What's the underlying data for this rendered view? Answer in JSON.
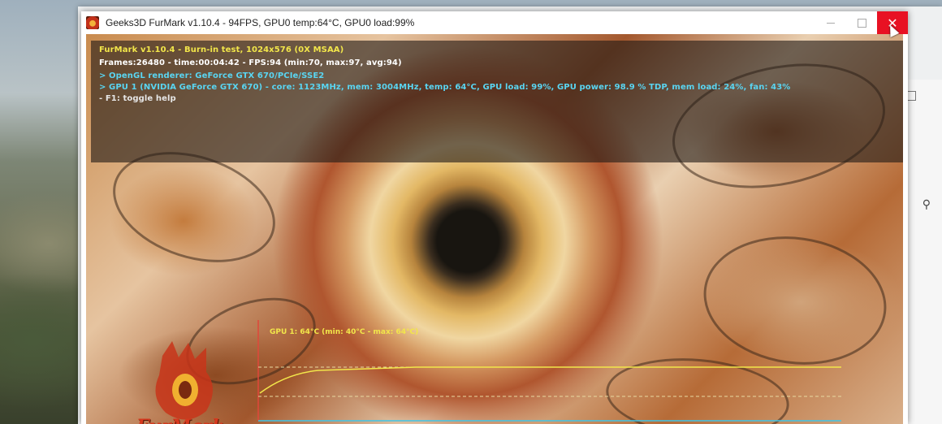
{
  "window": {
    "title": "Geeks3D FurMark v1.10.4 - 94FPS, GPU0 temp:64°C, GPU0 load:99%",
    "close_glyph": "✕"
  },
  "overlay": {
    "title_line": "FurMark v1.10.4 - Burn-in test, 1024x576 (0X MSAA)",
    "frames_line": "Frames:26480 - time:00:04:42 - FPS:94 (min:70, max:97, avg:94)",
    "renderer_line": "> OpenGL renderer: GeForce GTX 670/PCIe/SSE2",
    "gpu_line": "> GPU 1 (NVIDIA GeForce GTX 670) - core: 1123MHz, mem: 3004MHz, temp: 64°C, GPU load: 99%, GPU power: 98.9 % TDP, mem load: 24%, fan: 43%",
    "help_line": "- F1: toggle help"
  },
  "graph": {
    "label": "GPU 1: 64°C (min: 40°C - max: 64°C)",
    "min_temp": 40,
    "max_temp": 64,
    "current_temp": 64
  },
  "logo": {
    "text": "FurMark"
  },
  "colors": {
    "overlay_title": "#f2e64a",
    "overlay_info": "#59d5f2",
    "close_button": "#e81123"
  }
}
